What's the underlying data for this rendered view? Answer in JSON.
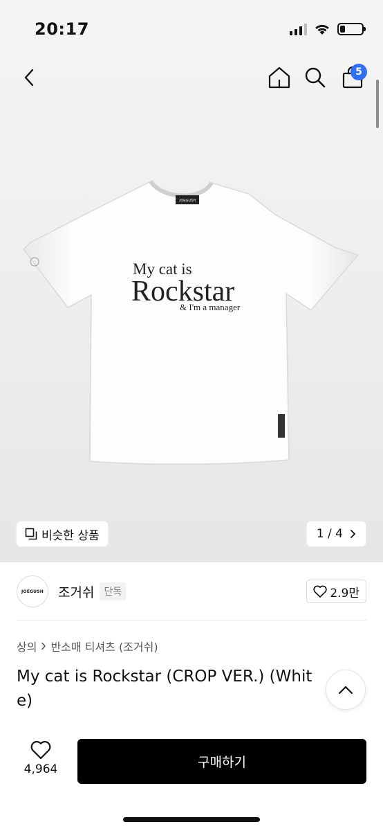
{
  "status_bar": {
    "time": "20:17"
  },
  "header": {
    "cart_count": "5"
  },
  "product_image": {
    "shirt_text_line1": "My cat is",
    "shirt_text_line2": "Rockstar",
    "shirt_text_line3": "& I'm a manager",
    "neck_label": "JOEGUSH"
  },
  "image_actions": {
    "similar_label": "비슷한 상품",
    "page_indicator": "1 / 4"
  },
  "brand": {
    "logo_text": "JOEGUSH",
    "name": "조거쉬",
    "tag": "단독",
    "like_count": "2.9만"
  },
  "breadcrumb": {
    "category": "상의",
    "subcategory": "반소매 티셔츠 (조거쉬)"
  },
  "product": {
    "title": "My cat is Rockstar (CROP VER.) (White)"
  },
  "bottom_bar": {
    "wish_count": "4,964",
    "buy_label": "구매하기"
  }
}
